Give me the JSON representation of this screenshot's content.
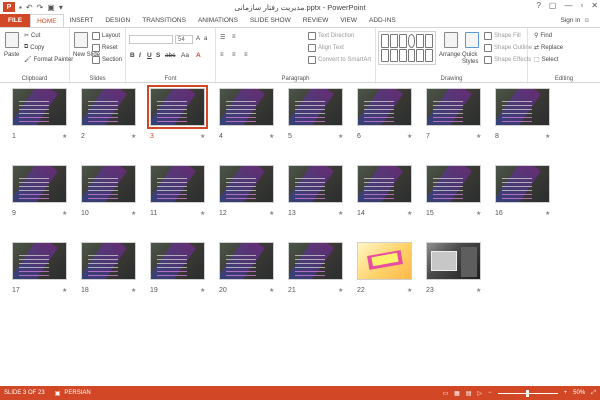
{
  "titlebar": {
    "title": "مدیریت رفتار سازمانی.pptx - PowerPoint",
    "app_icon": "P",
    "qat": [
      "save-icon",
      "undo-icon",
      "redo-icon",
      "start-from-beginning-icon",
      "customize-icon"
    ],
    "controls": [
      "?",
      "▢",
      "—",
      "▫",
      "✕"
    ]
  },
  "tabs": [
    "FILE",
    "HOME",
    "INSERT",
    "DESIGN",
    "TRANSITIONS",
    "ANIMATIONS",
    "SLIDE SHOW",
    "REVIEW",
    "VIEW",
    "ADD-INS"
  ],
  "active_tab": "HOME",
  "signin": "Sign in",
  "ribbon": {
    "clipboard": {
      "label": "Clipboard",
      "paste": "Paste",
      "cut": "Cut",
      "copy": "Copy",
      "format_painter": "Format Painter"
    },
    "slides": {
      "label": "Slides",
      "new_slide": "New Slide",
      "layout": "Layout",
      "reset": "Reset",
      "section": "Section"
    },
    "font": {
      "label": "Font",
      "font_size": "54",
      "bold": "B",
      "italic": "I",
      "underline": "U",
      "shadow": "S",
      "strike": "abc",
      "case": "Aa"
    },
    "paragraph": {
      "label": "Paragraph",
      "text_direction": "Text Direction",
      "align_text": "Align Text",
      "smartart": "Convert to SmartArt"
    },
    "drawing": {
      "label": "Drawing",
      "arrange": "Arrange",
      "quick_styles": "Quick Styles",
      "shape_fill": "Shape Fill",
      "shape_outline": "Shape Outline",
      "shape_effects": "Shape Effects"
    },
    "editing": {
      "label": "Editing",
      "find": "Find",
      "replace": "Replace",
      "select": "Select"
    }
  },
  "slides": [
    {
      "num": "1",
      "style": "dark"
    },
    {
      "num": "2",
      "style": "dark"
    },
    {
      "num": "3",
      "style": "dark",
      "selected": true
    },
    {
      "num": "4",
      "style": "dark"
    },
    {
      "num": "5",
      "style": "dark"
    },
    {
      "num": "6",
      "style": "dark"
    },
    {
      "num": "7",
      "style": "dark"
    },
    {
      "num": "8",
      "style": "dark"
    },
    {
      "num": "9",
      "style": "dark"
    },
    {
      "num": "10",
      "style": "dark"
    },
    {
      "num": "11",
      "style": "dark"
    },
    {
      "num": "12",
      "style": "dark"
    },
    {
      "num": "13",
      "style": "dark"
    },
    {
      "num": "14",
      "style": "dark"
    },
    {
      "num": "15",
      "style": "dark"
    },
    {
      "num": "16",
      "style": "dark"
    },
    {
      "num": "17",
      "style": "dark"
    },
    {
      "num": "18",
      "style": "dark"
    },
    {
      "num": "19",
      "style": "dark"
    },
    {
      "num": "20",
      "style": "dark"
    },
    {
      "num": "21",
      "style": "dark"
    },
    {
      "num": "22",
      "style": "light"
    },
    {
      "num": "23",
      "style": "photo"
    }
  ],
  "star_glyph": "★",
  "status": {
    "slide_info": "SLIDE 3 OF 23",
    "language": "PERSIAN",
    "zoom": "50%",
    "zoom_minus": "−",
    "zoom_plus": "+"
  }
}
